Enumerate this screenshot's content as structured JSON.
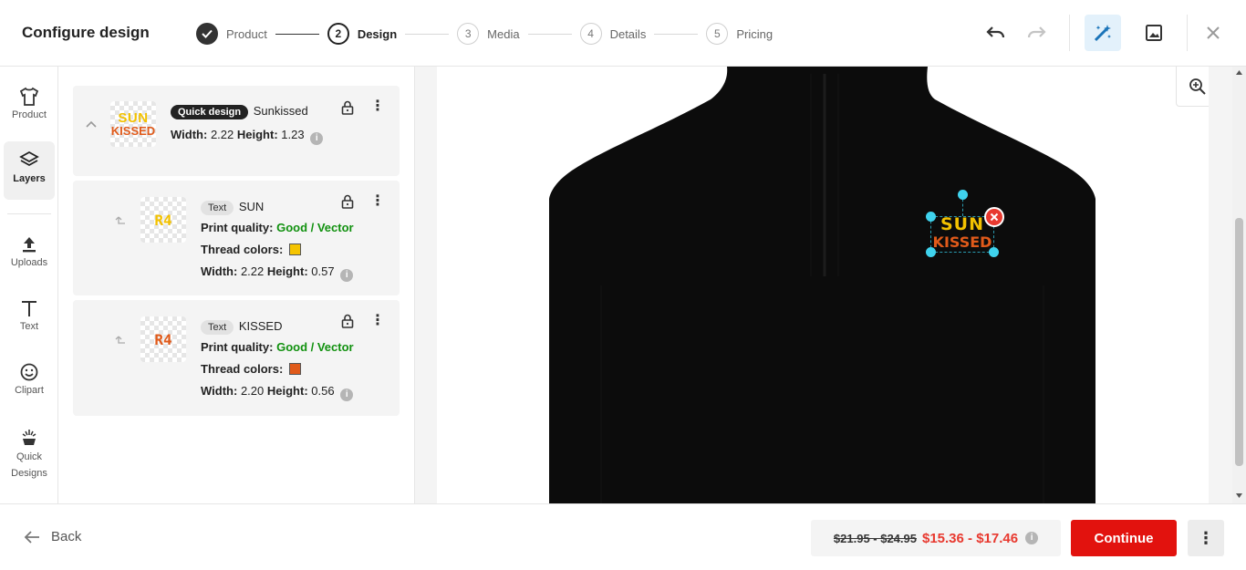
{
  "header": {
    "title": "Configure design",
    "steps": [
      {
        "number": "",
        "label": "Product",
        "state": "done"
      },
      {
        "number": "2",
        "label": "Design",
        "state": "active"
      },
      {
        "number": "3",
        "label": "Media",
        "state": "upcoming"
      },
      {
        "number": "4",
        "label": "Details",
        "state": "upcoming"
      },
      {
        "number": "5",
        "label": "Pricing",
        "state": "upcoming"
      }
    ],
    "actions": [
      "undo-icon",
      "redo-icon",
      "magic-wand-icon",
      "image-icon",
      "close-icon"
    ]
  },
  "rail": {
    "items": [
      {
        "label": "Product",
        "icon": "tshirt-icon"
      },
      {
        "label": "Layers",
        "icon": "layers-icon"
      },
      {
        "label": "Uploads",
        "icon": "upload-icon"
      },
      {
        "label": "Text",
        "icon": "text-icon"
      },
      {
        "label": "Clipart",
        "icon": "smiley-icon"
      },
      {
        "label": "Quick Designs",
        "icon": "sparkle-paint-icon"
      }
    ]
  },
  "layers": {
    "group": {
      "badge": "Quick design",
      "name": "Sunkissed",
      "width_label": "Width:",
      "width": "2.22",
      "height_label": "Height:",
      "height": "1.23",
      "thumb_line1": "SUN",
      "thumb_line2": "KISSED"
    },
    "items": [
      {
        "badge": "Text",
        "name": "SUN",
        "quality_label": "Print quality:",
        "quality": "Good / Vector",
        "thread_label": "Thread colors:",
        "thread_color": "#f5c400",
        "width_label": "Width:",
        "width": "2.22",
        "height_label": "Height:",
        "height": "0.57",
        "glyph_color": "#f2c100"
      },
      {
        "badge": "Text",
        "name": "KISSED",
        "quality_label": "Print quality:",
        "quality": "Good / Vector",
        "thread_label": "Thread colors:",
        "thread_color": "#e05a1a",
        "width_label": "Width:",
        "width": "2.20",
        "height_label": "Height:",
        "height": "0.56",
        "glyph_color": "#e05a1a"
      }
    ]
  },
  "canvas": {
    "design_line1": "SUN",
    "design_line2": "KISSED",
    "garment_color": "#0c0c0c"
  },
  "footer": {
    "back_label": "Back",
    "old_price": "$21.95 - $24.95",
    "new_price": "$15.36 - $17.46",
    "continue_label": "Continue"
  },
  "colors": {
    "accent_red": "#e2120e",
    "sale_red": "#e8392f",
    "good_green": "#11910f",
    "active_blue": "#1b74b9"
  }
}
